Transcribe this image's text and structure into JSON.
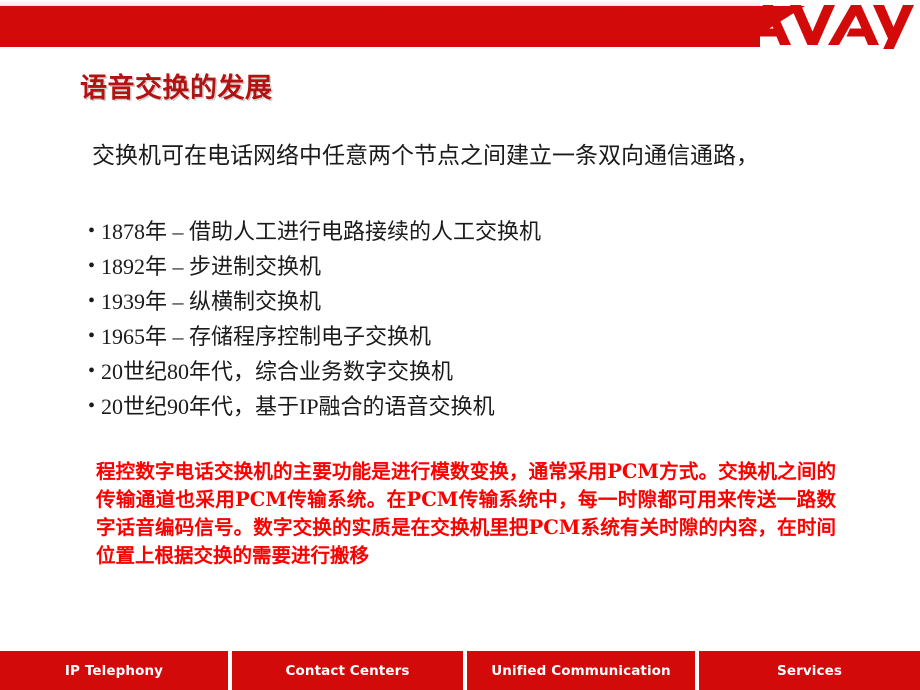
{
  "header": {
    "logo_text": "AVAYA",
    "logo_name": "avaya-logo"
  },
  "title": "语音交换的发展",
  "content": {
    "intro": "交换机可在电话网络中任意两个节点之间建立一条双向通信通路，",
    "bullet_marker": "•",
    "bullets": [
      "1878年 – 借助人工进行电路接续的人工交换机",
      "1892年 – 步进制交换机",
      "1939年 – 纵横制交换机",
      "1965年 – 存储程序控制电子交换机",
      "20世纪80年代，综合业务数字交换机",
      "20世纪90年代，基于IP融合的语音交换机"
    ],
    "highlight_paragraph": "程控数字电话交换机的主要功能是进行模数变换，通常采用PCM方式。交换机之间的传输通道也采用PCM传输系统。在PCM传输系统中，每一时隙都可用来传送一路数字话音编码信号。数字交换的实质是在交换机里把PCM系统有关时隙的内容，在时间位置上根据交换的需要进行搬移"
  },
  "footer": {
    "items": [
      {
        "label": "IP Telephony"
      },
      {
        "label": "Contact Centers"
      },
      {
        "label": "Unified Communication"
      },
      {
        "label": "Services"
      }
    ]
  },
  "colors": {
    "brand_red": "#d20a0a",
    "title_red": "#b31212",
    "highlight_red": "#fc0000",
    "body_text": "#1b1b1b",
    "footer_text": "#ffffff"
  }
}
